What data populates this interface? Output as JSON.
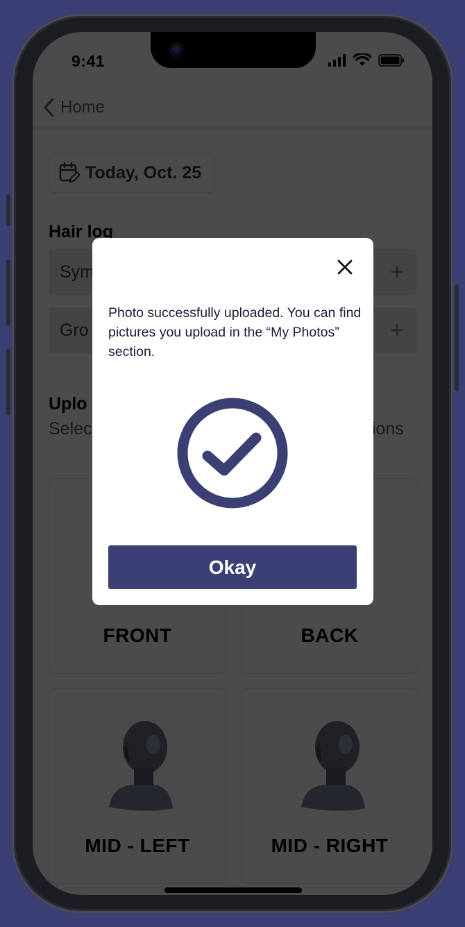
{
  "status_bar": {
    "time": "9:41",
    "signal_icon": "signal-icon",
    "wifi_icon": "wifi-icon",
    "battery_icon": "battery-icon"
  },
  "nav": {
    "back_label": "Home",
    "back_icon": "chevron-left-icon"
  },
  "date_chip": {
    "label": "Today, Oct. 25",
    "icon": "calendar-edit-icon"
  },
  "hair_log": {
    "title": "Hair log",
    "rows": [
      {
        "label": "Sym"
      },
      {
        "label": "Gro"
      }
    ],
    "add_icon": "plus-icon"
  },
  "upload": {
    "title": "Uplo",
    "subtitle_left": "Selec",
    "subtitle_right": "tions"
  },
  "cards": [
    {
      "label": "FRONT"
    },
    {
      "label": "BACK"
    },
    {
      "label": "MID - LEFT"
    },
    {
      "label": "MID - RIGHT"
    }
  ],
  "modal": {
    "message": "Photo successfully uploaded. You can find pictures you upload in the “My Photos” section.",
    "button_label": "Okay",
    "close_icon": "close-icon",
    "success_icon": "check-circle-icon",
    "accent_color": "#3b3f73"
  },
  "colors": {
    "background": "#3b3f73",
    "overlay": "#4b4b4b",
    "accent": "#3b3f73"
  }
}
